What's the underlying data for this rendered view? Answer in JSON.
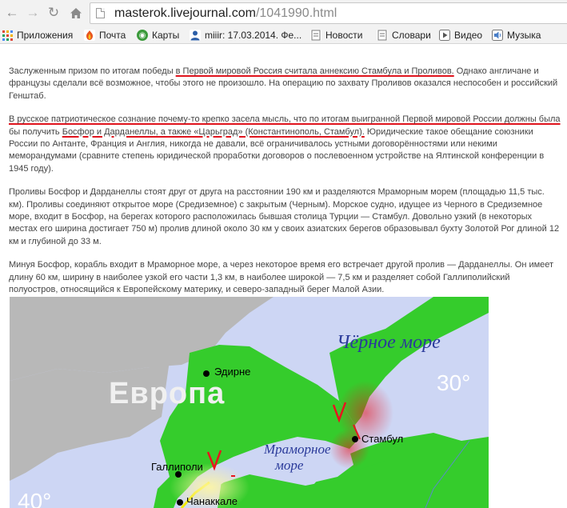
{
  "browser": {
    "url_host": "masterok.livejournal.com",
    "url_path": "/1041990.html",
    "back_icon": "back-arrow-icon",
    "forward_icon": "forward-arrow-icon",
    "reload_icon": "reload-icon",
    "home_icon": "home-icon"
  },
  "bookmarks": [
    {
      "label": "Приложения",
      "icon": "apps-grid-icon"
    },
    {
      "label": "Почта",
      "icon": "mail-icon"
    },
    {
      "label": "Карты",
      "icon": "maps-icon"
    },
    {
      "label": "miiir: 17.03.2014. Фе...",
      "icon": "user-icon"
    },
    {
      "label": "Новости",
      "icon": "page-icon"
    },
    {
      "label": "Словари",
      "icon": "page-icon"
    },
    {
      "label": "Видео",
      "icon": "video-icon"
    },
    {
      "label": "Музыка",
      "icon": "music-icon"
    }
  ],
  "article": {
    "p1_a": "Заслуженным призом по итогам победы ",
    "p1_u": "в Первой мировой Россия считала аннексию Стамбула и Проливов.",
    "p1_b": " Однако англичане и французы сделали всё возможное, чтобы этого не произошло. На операцию по захвату Проливов оказался неспособен и российский Генштаб.",
    "p2_u1": "В русское патриотическое сознание почему-то крепко засела мысль, что по итогам выигранной Первой мировой России должны была",
    "p2_a": " бы получить ",
    "p2_u2": "Босфор и Дарданеллы, а также «Царьград» (Константинополь, Стамбул).",
    "p2_b": " Юридические такое обещание союзники России по Антанте, Франция и Англия, никогда не давали, всё ограничивалось устными договорённостями или некими меморандумами (сравните степень юридической проработки договоров о послевоенном устройстве на Ялтинской конференции в 1945 году).",
    "p3": "Проливы Босфор и Дарданеллы стоят друг от друга на расстоянии 190 км и разделяются Мраморным морем (площадью 11,5 тыс. км). Проливы соединяют открытое море (Средиземное) с закрытым (Черным). Морское судно, идущее из Черного в Средиземное море, входит в Босфор, на берегах которого расположилась бывшая столица Турции — Стамбул. Довольно узкий (в некоторых местах его ширина достигает 750 м) пролив длиной около 30 км у своих азиатских берегов образовывал бухту Золотой Рог длиной 12 км и глубиной до 33 м.",
    "p4": "Минуя Босфор, корабль входит в Мраморное море, а через некоторое время его встречает другой пролив — Дарданеллы. Он имеет длину 60 км, ширину в наиболее узкой его части 1,3 км, в наиболее широкой — 7,5 км и разделяет собой Галлиполийский полуостров, относящийся к Европейскому материку, и северо-западный берег Малой Азии."
  },
  "map": {
    "black_sea": "Чёрное море",
    "europe": "Европа",
    "marmara_1": "Мраморное",
    "marmara_2": "море",
    "edirne": "Эдирне",
    "istanbul": "Стамбул",
    "gallipoli": "Галлиполи",
    "canakkale": "Чанаккале",
    "lon_30": "30°",
    "lon_40": "40°",
    "annotation_mark": "V",
    "colors": {
      "sea": "#cdd6f4",
      "land_turkey": "#35cc2c",
      "land_other": "#b8b8b8",
      "annotation": "#e8141e"
    }
  }
}
